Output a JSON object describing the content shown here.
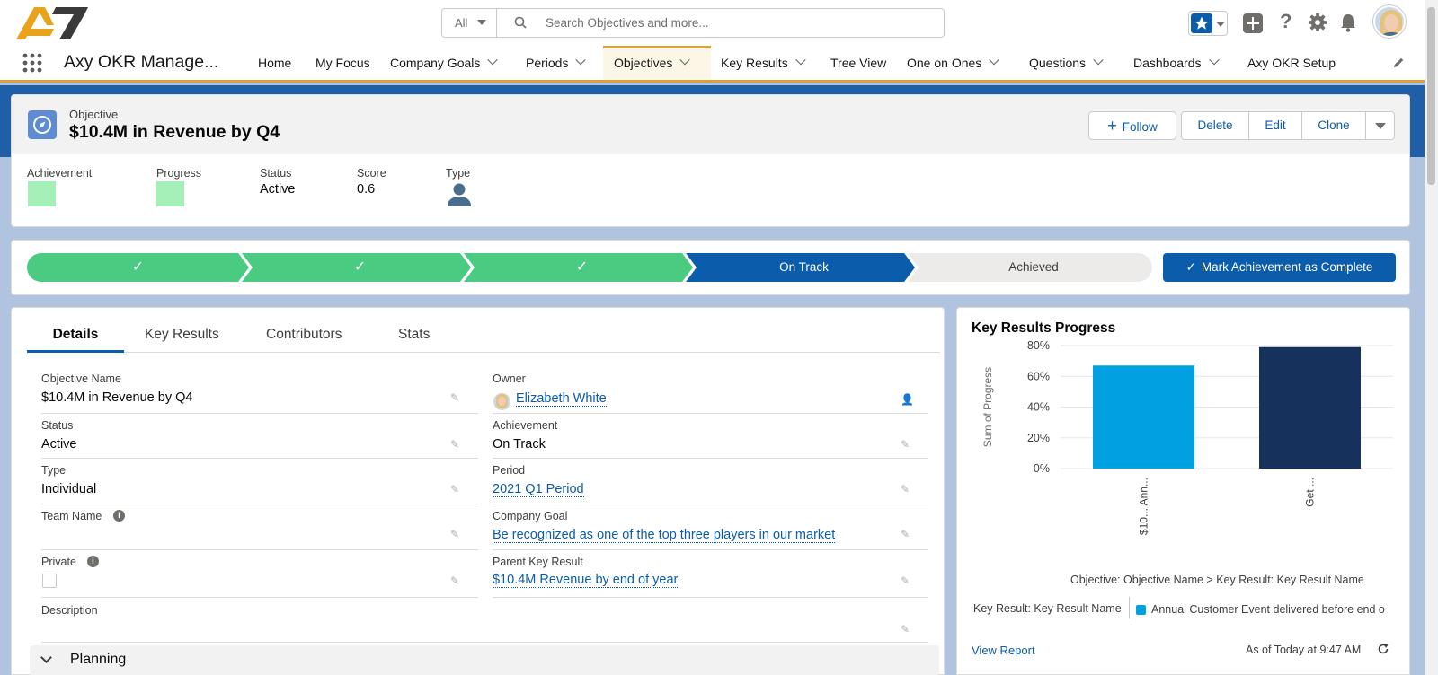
{
  "colors": {
    "brand_gold": "#d8a43a",
    "path_green": "#4bca81",
    "path_current": "#0b5cab",
    "chart_light_blue": "#00a1e0",
    "chart_dark_navy": "#16325c",
    "link_blue": "#0b5cab"
  },
  "header": {
    "logo_text": "A7",
    "search": {
      "scope": "All",
      "placeholder": "Search Objectives and more..."
    },
    "icons": [
      "favorites-star-icon",
      "add-icon",
      "help-icon",
      "setup-gear-icon",
      "notifications-bell-icon",
      "user-avatar"
    ]
  },
  "nav": {
    "app_name": "Axy OKR Manage...",
    "items": [
      {
        "label": "Home",
        "has_menu": false
      },
      {
        "label": "My Focus",
        "has_menu": false
      },
      {
        "label": "Company Goals",
        "has_menu": true
      },
      {
        "label": "Periods",
        "has_menu": true
      },
      {
        "label": "Objectives",
        "has_menu": true,
        "active": true
      },
      {
        "label": "Key Results",
        "has_menu": true
      },
      {
        "label": "Tree View",
        "has_menu": false
      },
      {
        "label": "One on Ones",
        "has_menu": true
      },
      {
        "label": "Questions",
        "has_menu": true
      },
      {
        "label": "Dashboards",
        "has_menu": true
      },
      {
        "label": "Axy OKR Setup",
        "has_menu": false
      }
    ]
  },
  "record": {
    "object_label": "Objective",
    "title": "$10.4M in Revenue by Q4",
    "actions": {
      "follow": "Follow",
      "delete": "Delete",
      "edit": "Edit",
      "clone": "Clone"
    },
    "highlights": [
      {
        "label": "Achievement",
        "value": ""
      },
      {
        "label": "Progress",
        "value": ""
      },
      {
        "label": "Status",
        "value": "Active"
      },
      {
        "label": "Score",
        "value": "0.6"
      },
      {
        "label": "Type",
        "value": ""
      }
    ]
  },
  "path": {
    "steps": [
      {
        "label": "✓",
        "state": "complete"
      },
      {
        "label": "✓",
        "state": "complete"
      },
      {
        "label": "✓",
        "state": "complete"
      },
      {
        "label": "On Track",
        "state": "current"
      },
      {
        "label": "Achieved",
        "state": "incomplete"
      }
    ],
    "mark_complete_label": "Mark Achievement as Complete"
  },
  "tabs": [
    "Details",
    "Key Results",
    "Contributors",
    "Stats"
  ],
  "details": {
    "left": [
      {
        "label": "Objective Name",
        "value": "$10.4M in Revenue by Q4"
      },
      {
        "label": "Status",
        "value": "Active"
      },
      {
        "label": "Type",
        "value": "Individual"
      },
      {
        "label": "Team Name",
        "value": ""
      },
      {
        "label": "Private",
        "value": ""
      },
      {
        "label": "Description",
        "value": ""
      }
    ],
    "right": [
      {
        "label": "Owner",
        "value": "Elizabeth White"
      },
      {
        "label": "Achievement",
        "value": "On Track"
      },
      {
        "label": "Period",
        "value": "2021 Q1 Period"
      },
      {
        "label": "Company Goal",
        "value": "Be recognized as one of the top three players in our market"
      },
      {
        "label": "Parent Key Result",
        "value": "$10.4M Revenue by end of year"
      }
    ],
    "section_planning": "Planning"
  },
  "report": {
    "title": "Key Results Progress",
    "grouping_caption": "Objective: Objective Name > Key Result: Key Result Name",
    "legend_label": "Key Result: Key Result Name",
    "legend_entry": "Annual Customer Event delivered before end o",
    "view_report": "View Report",
    "refreshed": "As of Today at 9:47 AM"
  },
  "chart_data": {
    "type": "bar",
    "ylabel": "Sum of Progress",
    "yticks": [
      "80%",
      "60%",
      "40%",
      "20%",
      "0%"
    ],
    "ylim": [
      0,
      80
    ],
    "grid": true,
    "categories": [
      "$10... Ann...",
      "Get ..."
    ],
    "values": [
      67,
      79
    ],
    "bar_colors": [
      "#00a1e0",
      "#16325c"
    ]
  }
}
